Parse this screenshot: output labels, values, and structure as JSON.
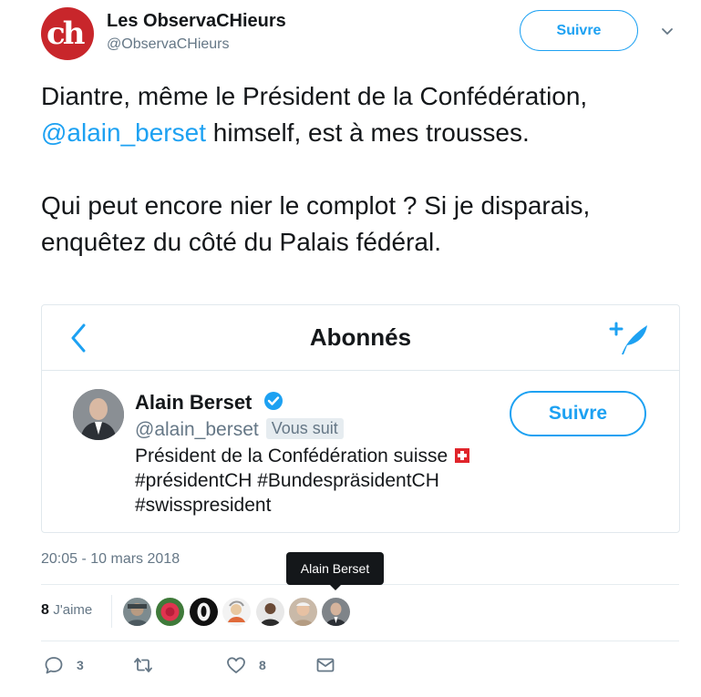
{
  "author": {
    "name": "Les ObservaCHieurs",
    "handle": "@ObservaCHieurs",
    "avatar_text": "ch",
    "follow_label": "Suivre"
  },
  "tweet": {
    "line1_pre": "Diantre, même le Président de la Confédération, ",
    "mention": "@alain_berset",
    "line1_post": " himself, est à mes trousses.",
    "paragraph2": "Qui peut encore nier le complot ? Si je disparais, enquêtez du côté du Palais fédéral."
  },
  "screenshot_card": {
    "title": "Abonnés",
    "profile": {
      "name": "Alain Berset",
      "handle": "@alain_berset",
      "follows_you": "Vous suit",
      "bio_line1": "Président de la Confédération suisse",
      "bio_line2": "#présidentCH #BundespräsidentCH",
      "bio_line3": "#swisspresident",
      "follow_label": "Suivre"
    }
  },
  "timestamp": "20:05 - 10 mars 2018",
  "likes": {
    "count": "8",
    "label": "J'aime",
    "tooltip": "Alain Berset"
  },
  "actions": {
    "replies": "3",
    "likes": "8"
  },
  "colors": {
    "accent": "#1da1f2",
    "text": "#14171a",
    "muted": "#657786",
    "brand_red": "#c8262b"
  }
}
